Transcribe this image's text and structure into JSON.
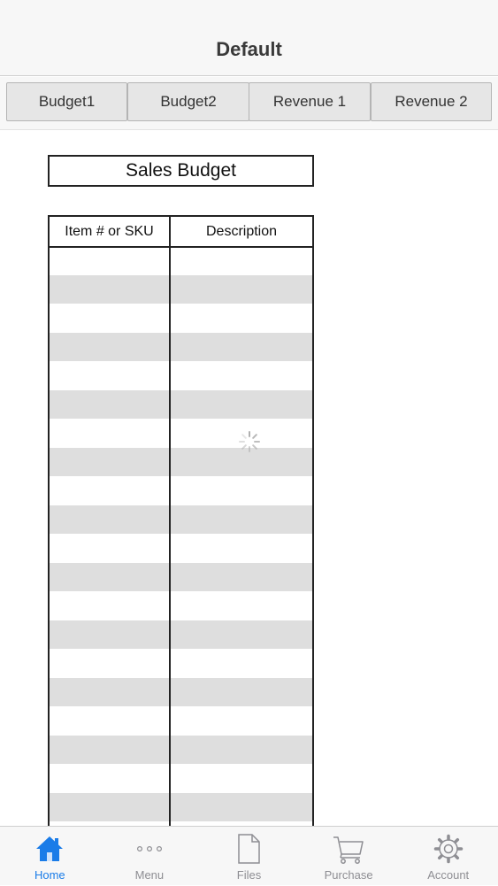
{
  "header": {
    "title": "Default"
  },
  "tabs": [
    {
      "label": "Budget1"
    },
    {
      "label": "Budget2"
    },
    {
      "label": "Revenue 1"
    },
    {
      "label": "Revenue 2"
    }
  ],
  "sheet": {
    "title": "Sales Budget",
    "columns": [
      "Item # or SKU",
      "Description"
    ],
    "rows": [
      [
        "",
        ""
      ],
      [
        "",
        ""
      ],
      [
        "",
        ""
      ],
      [
        "",
        ""
      ],
      [
        "",
        ""
      ],
      [
        "",
        ""
      ],
      [
        "",
        ""
      ],
      [
        "",
        ""
      ],
      [
        "",
        ""
      ],
      [
        "",
        ""
      ],
      [
        "",
        ""
      ],
      [
        "",
        ""
      ],
      [
        "",
        ""
      ],
      [
        "",
        ""
      ],
      [
        "",
        ""
      ],
      [
        "",
        ""
      ],
      [
        "",
        ""
      ],
      [
        "",
        ""
      ],
      [
        "",
        ""
      ],
      [
        "",
        ""
      ]
    ]
  },
  "tab_bar": {
    "items": [
      {
        "label": "Home",
        "icon": "home-icon",
        "active": true
      },
      {
        "label": "Menu",
        "icon": "more-dots-icon",
        "active": false
      },
      {
        "label": "Files",
        "icon": "file-icon",
        "active": false
      },
      {
        "label": "Purchase",
        "icon": "cart-icon",
        "active": false
      },
      {
        "label": "Account",
        "icon": "gear-icon",
        "active": false
      }
    ]
  },
  "colors": {
    "accent": "#1a7ce8",
    "inactive": "#8e8e93",
    "stripe": "#dedede"
  }
}
